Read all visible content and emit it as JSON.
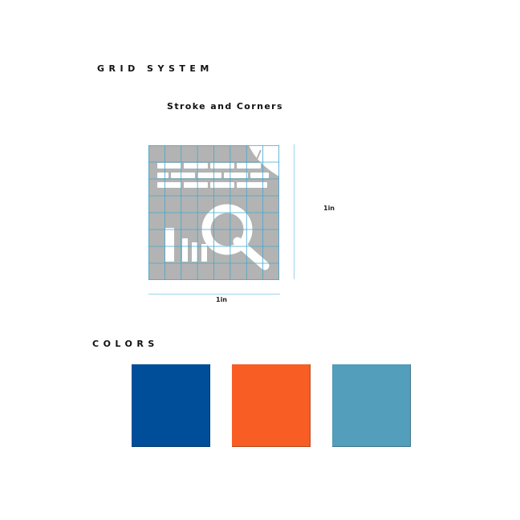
{
  "grid_section": {
    "title": "GRID SYSTEM",
    "subtitle": "Stroke and Corners",
    "height_label": "1in",
    "width_label": "1in"
  },
  "logo": {
    "background_color": "#b3b3b3",
    "grid_line_color": "#41a8cc",
    "mark_color": "#ffffff",
    "grid_columns": 8,
    "grid_rows": 8,
    "icons": [
      "brick-wall-icon",
      "trowel-icon",
      "magnifying-glass-icon",
      "bar-chart-icon"
    ]
  },
  "colors_section": {
    "title": "COLORS",
    "swatches": [
      {
        "name": "blue",
        "hex": "#004e99"
      },
      {
        "name": "orange",
        "hex": "#f85d24"
      },
      {
        "name": "light-blue",
        "hex": "#539ebb"
      }
    ]
  }
}
